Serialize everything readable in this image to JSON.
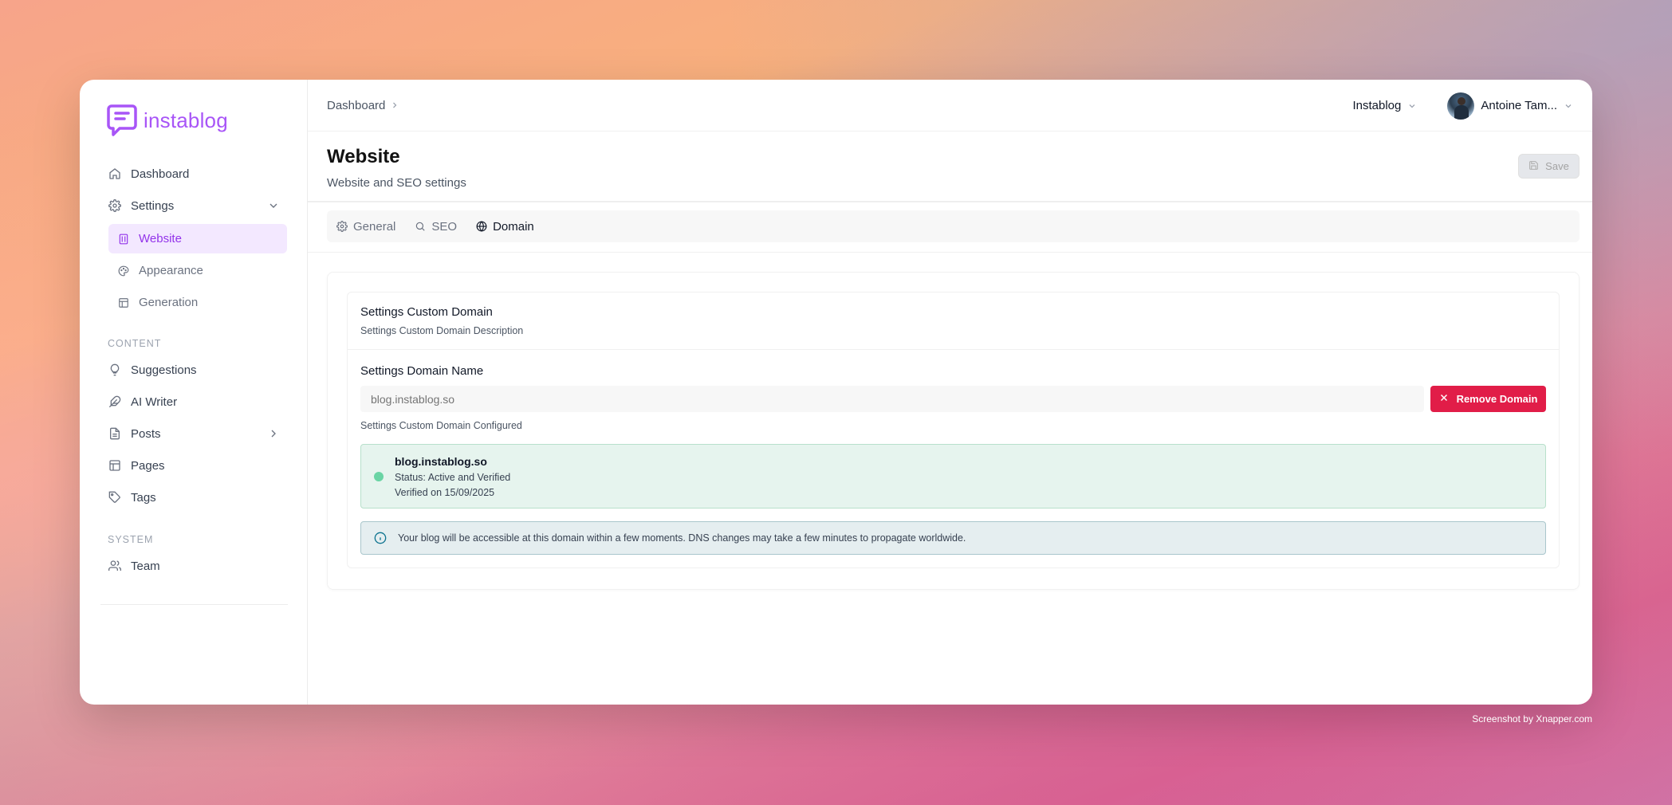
{
  "brand": {
    "name": "instablog",
    "accent": "#a855f7"
  },
  "sidebar": {
    "items": [
      {
        "label": "Dashboard",
        "icon": "home-icon"
      },
      {
        "label": "Settings",
        "icon": "gear-icon"
      }
    ],
    "settings_sub": [
      {
        "label": "Website",
        "icon": "building-icon",
        "active": true
      },
      {
        "label": "Appearance",
        "icon": "palette-icon"
      },
      {
        "label": "Generation",
        "icon": "layout-icon"
      }
    ],
    "content_label": "CONTENT",
    "content_items": [
      {
        "label": "Suggestions",
        "icon": "lightbulb-icon"
      },
      {
        "label": "AI Writer",
        "icon": "feather-icon"
      },
      {
        "label": "Posts",
        "icon": "file-icon"
      },
      {
        "label": "Pages",
        "icon": "table-icon"
      },
      {
        "label": "Tags",
        "icon": "tag-icon"
      }
    ],
    "system_label": "SYSTEM",
    "system_items": [
      {
        "label": "Team",
        "icon": "users-icon"
      }
    ]
  },
  "topbar": {
    "breadcrumb": "Dashboard",
    "workspace": "Instablog",
    "user_name": "Antoine Tam..."
  },
  "header": {
    "title": "Website",
    "subtitle": "Website and SEO settings",
    "save_label": "Save"
  },
  "tabs": [
    {
      "label": "General",
      "icon": "gear-icon"
    },
    {
      "label": "SEO",
      "icon": "search-icon"
    },
    {
      "label": "Domain",
      "icon": "globe-icon",
      "active": true
    }
  ],
  "domain_panel": {
    "title": "Settings Custom Domain",
    "description": "Settings Custom Domain Description",
    "field_label": "Settings Domain Name",
    "field_placeholder": "blog.instablog.so",
    "remove_label": "Remove Domain",
    "help_text": "Settings Custom Domain Configured",
    "status": {
      "domain": "blog.instablog.so",
      "status_text": "Status: Active and Verified",
      "verified_text": "Verified on 15/09/2025",
      "color": "#6ad4a4"
    },
    "info_text": "Your blog will be accessible at this domain within a few moments. DNS changes may take a few minutes to propagate worldwide."
  },
  "watermark": "Screenshot by Xnapper.com"
}
